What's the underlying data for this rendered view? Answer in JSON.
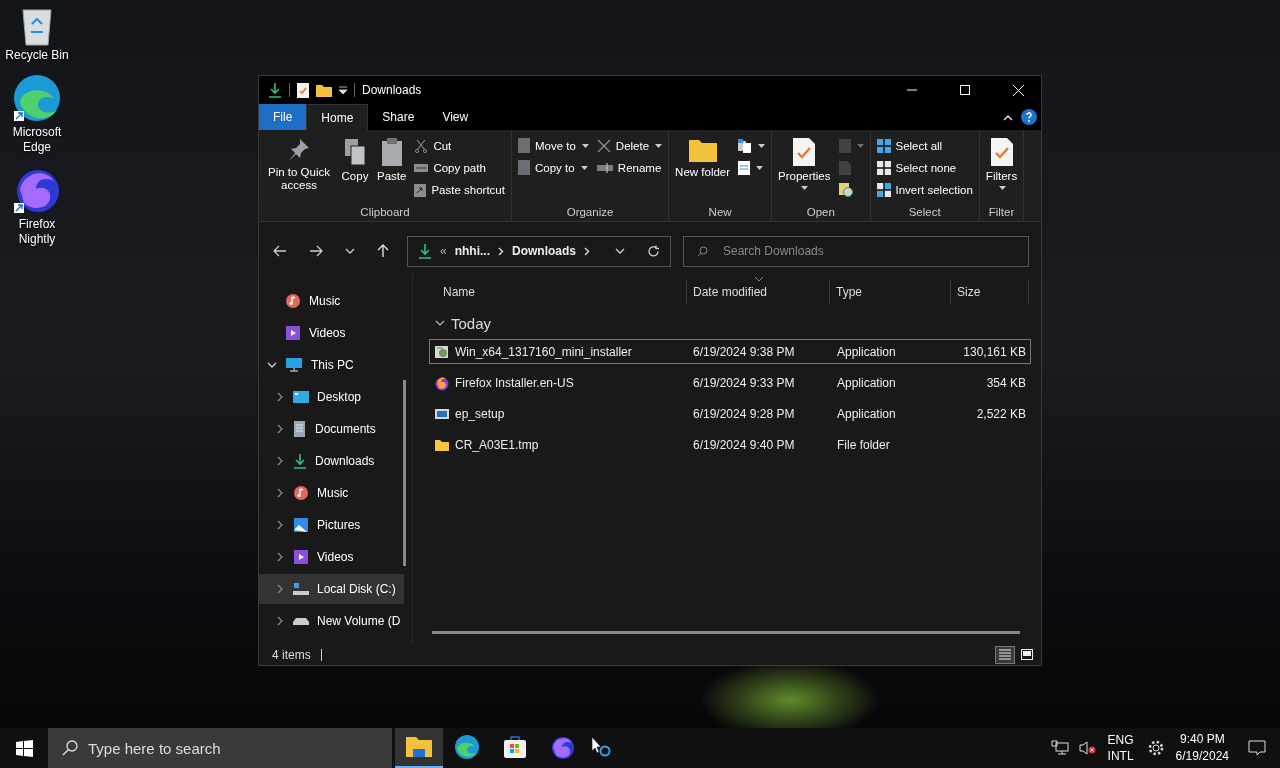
{
  "desktop_icons": [
    {
      "label": "Recycle Bin",
      "kind": "recycle"
    },
    {
      "label": "Microsoft Edge",
      "kind": "edge"
    },
    {
      "label": "Firefox Nightly",
      "kind": "firefox"
    }
  ],
  "window": {
    "title": "Downloads"
  },
  "ribbon_tabs": [
    {
      "label": "File",
      "kind": "file",
      "selected": false
    },
    {
      "label": "Home",
      "kind": "tab",
      "selected": true
    },
    {
      "label": "Share",
      "kind": "tab",
      "selected": false
    },
    {
      "label": "View",
      "kind": "tab",
      "selected": false
    }
  ],
  "ribbon_groups": [
    {
      "label": "Clipboard",
      "columns": [
        {
          "kind": "large",
          "items": [
            {
              "label": "Pin to Quick access",
              "kind": "pin",
              "dropdown": false,
              "disabled": false
            }
          ]
        },
        {
          "kind": "large",
          "items": [
            {
              "label": "Copy",
              "kind": "copy",
              "dropdown": false,
              "disabled": false
            }
          ]
        },
        {
          "kind": "large",
          "items": [
            {
              "label": "Paste",
              "kind": "paste",
              "dropdown": false,
              "disabled": false
            }
          ]
        },
        {
          "kind": "small",
          "items": [
            {
              "label": "Cut",
              "kind": "cut",
              "dropdown": false,
              "disabled": false
            },
            {
              "label": "Copy path",
              "kind": "path",
              "dropdown": false,
              "disabled": false
            },
            {
              "label": "Paste shortcut",
              "kind": "shortcut",
              "dropdown": false,
              "disabled": false
            }
          ]
        }
      ]
    },
    {
      "label": "Organize",
      "columns": [
        {
          "kind": "small",
          "items": [
            {
              "label": "Move to",
              "kind": "move",
              "dropdown": true,
              "disabled": false
            },
            {
              "label": "Copy to",
              "kind": "copyto",
              "dropdown": true,
              "disabled": false
            }
          ]
        },
        {
          "kind": "small",
          "items": [
            {
              "label": "Delete",
              "kind": "delete",
              "dropdown": true,
              "disabled": false
            },
            {
              "label": "Rename",
              "kind": "rename",
              "dropdown": false,
              "disabled": false
            }
          ]
        }
      ]
    },
    {
      "label": "New",
      "columns": [
        {
          "kind": "large",
          "items": [
            {
              "label": "New folder",
              "kind": "folder",
              "dropdown": false,
              "disabled": false
            }
          ]
        },
        {
          "kind": "small",
          "items": [
            {
              "kind": "newitem",
              "dropdown": true,
              "disabled": false
            },
            {
              "kind": "easyaccess",
              "dropdown": true,
              "disabled": false
            }
          ]
        }
      ]
    },
    {
      "label": "Open",
      "columns": [
        {
          "kind": "large",
          "items": [
            {
              "label": "Properties",
              "kind": "properties",
              "dropdown": true,
              "disabled": false
            }
          ]
        },
        {
          "kind": "small",
          "items": [
            {
              "kind": "open",
              "dropdown": true,
              "disabled": true
            },
            {
              "kind": "edit",
              "dropdown": false,
              "disabled": true
            },
            {
              "kind": "history",
              "dropdown": false,
              "disabled": false
            }
          ]
        }
      ]
    },
    {
      "label": "Select",
      "columns": [
        {
          "kind": "small",
          "items": [
            {
              "label": "Select all",
              "kind": "selectall",
              "dropdown": false,
              "disabled": false
            },
            {
              "label": "Select none",
              "kind": "selectnone",
              "dropdown": false,
              "disabled": false
            },
            {
              "label": "Invert selection",
              "kind": "invert",
              "dropdown": false,
              "disabled": false
            }
          ]
        }
      ]
    },
    {
      "label": "Filter",
      "columns": [
        {
          "kind": "large",
          "items": [
            {
              "label": "Filters",
              "kind": "properties",
              "dropdown": true,
              "disabled": false
            }
          ]
        }
      ]
    }
  ],
  "address": {
    "overflow": "«",
    "segments": [
      "nhhi...",
      "Downloads"
    ]
  },
  "search": {
    "placeholder": "Search Downloads"
  },
  "sidebar": [
    {
      "label": "Music",
      "kind": "music",
      "selected": false
    },
    {
      "label": "Videos",
      "kind": "videos",
      "selected": false
    },
    {
      "label": "This PC",
      "kind": "pc",
      "selected": false,
      "expanded": true,
      "children": [
        {
          "label": "Desktop",
          "kind": "desktop",
          "selected": false,
          "expanded": false
        },
        {
          "label": "Documents",
          "kind": "documents",
          "selected": false,
          "expanded": false
        },
        {
          "label": "Downloads",
          "kind": "downloads",
          "selected": false,
          "expanded": false
        },
        {
          "label": "Music",
          "kind": "music",
          "selected": false,
          "expanded": false
        },
        {
          "label": "Pictures",
          "kind": "pictures",
          "selected": false,
          "expanded": false
        },
        {
          "label": "Videos",
          "kind": "videos",
          "selected": false,
          "expanded": false
        },
        {
          "label": "Local Disk (C:)",
          "kind": "disk",
          "selected": true,
          "expanded": false
        },
        {
          "label": "New Volume (D",
          "kind": "drive",
          "selected": false,
          "expanded": false
        }
      ]
    }
  ],
  "columns": [
    "Name",
    "Date modified",
    "Type",
    "Size"
  ],
  "groups": [
    {
      "label": "Today",
      "expanded": true,
      "rows": [
        {
          "name": "Win_x64_1317160_mini_installer",
          "date": "6/19/2024 9:38 PM",
          "type": "Application",
          "size": "130,161 KB",
          "kind": "installer",
          "selected": true
        },
        {
          "name": "Firefox Installer.en-US",
          "date": "6/19/2024 9:33 PM",
          "type": "Application",
          "size": "354 KB",
          "kind": "firefox",
          "selected": false
        },
        {
          "name": "ep_setup",
          "date": "6/19/2024 9:28 PM",
          "type": "Application",
          "size": "2,522 KB",
          "kind": "app",
          "selected": false
        },
        {
          "name": "CR_A03E1.tmp",
          "date": "6/19/2024 9:40 PM",
          "type": "File folder",
          "size": "",
          "kind": "folder",
          "selected": false
        }
      ]
    }
  ],
  "status_bar": {
    "count": "4 items",
    "views": [
      {
        "kind": "details",
        "selected": true
      },
      {
        "kind": "tiles",
        "selected": false
      }
    ]
  },
  "taskbar": {
    "search_placeholder": "Type here to search",
    "apps": [
      {
        "kind": "explorer",
        "selected": true
      },
      {
        "kind": "edge",
        "selected": false
      },
      {
        "kind": "store",
        "selected": false
      },
      {
        "kind": "firefox",
        "selected": false
      }
    ],
    "language": [
      "ENG",
      "INTL"
    ],
    "time": "9:40 PM",
    "date": "6/19/2024",
    "volume_muted": true
  }
}
